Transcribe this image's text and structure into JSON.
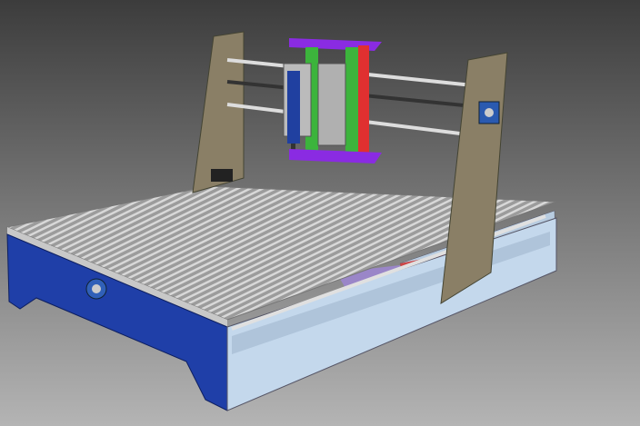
{
  "scene": {
    "colors": {
      "background_top": "#3c3c3c",
      "background_bottom": "#b4b4b4",
      "bed_top": "#a8a8a8",
      "bed_slot": "#d8d8d8",
      "side_panel": "#1f3fa8",
      "frame_panel": "#c4d8ec",
      "gantry_plate": "#8a7f66",
      "carriage_purple": "#8a2be2",
      "carriage_green": "#3cb43c",
      "carriage_red": "#e03030",
      "bearing_blue": "#2a5ab0",
      "rail": "#d0d0d0"
    }
  }
}
